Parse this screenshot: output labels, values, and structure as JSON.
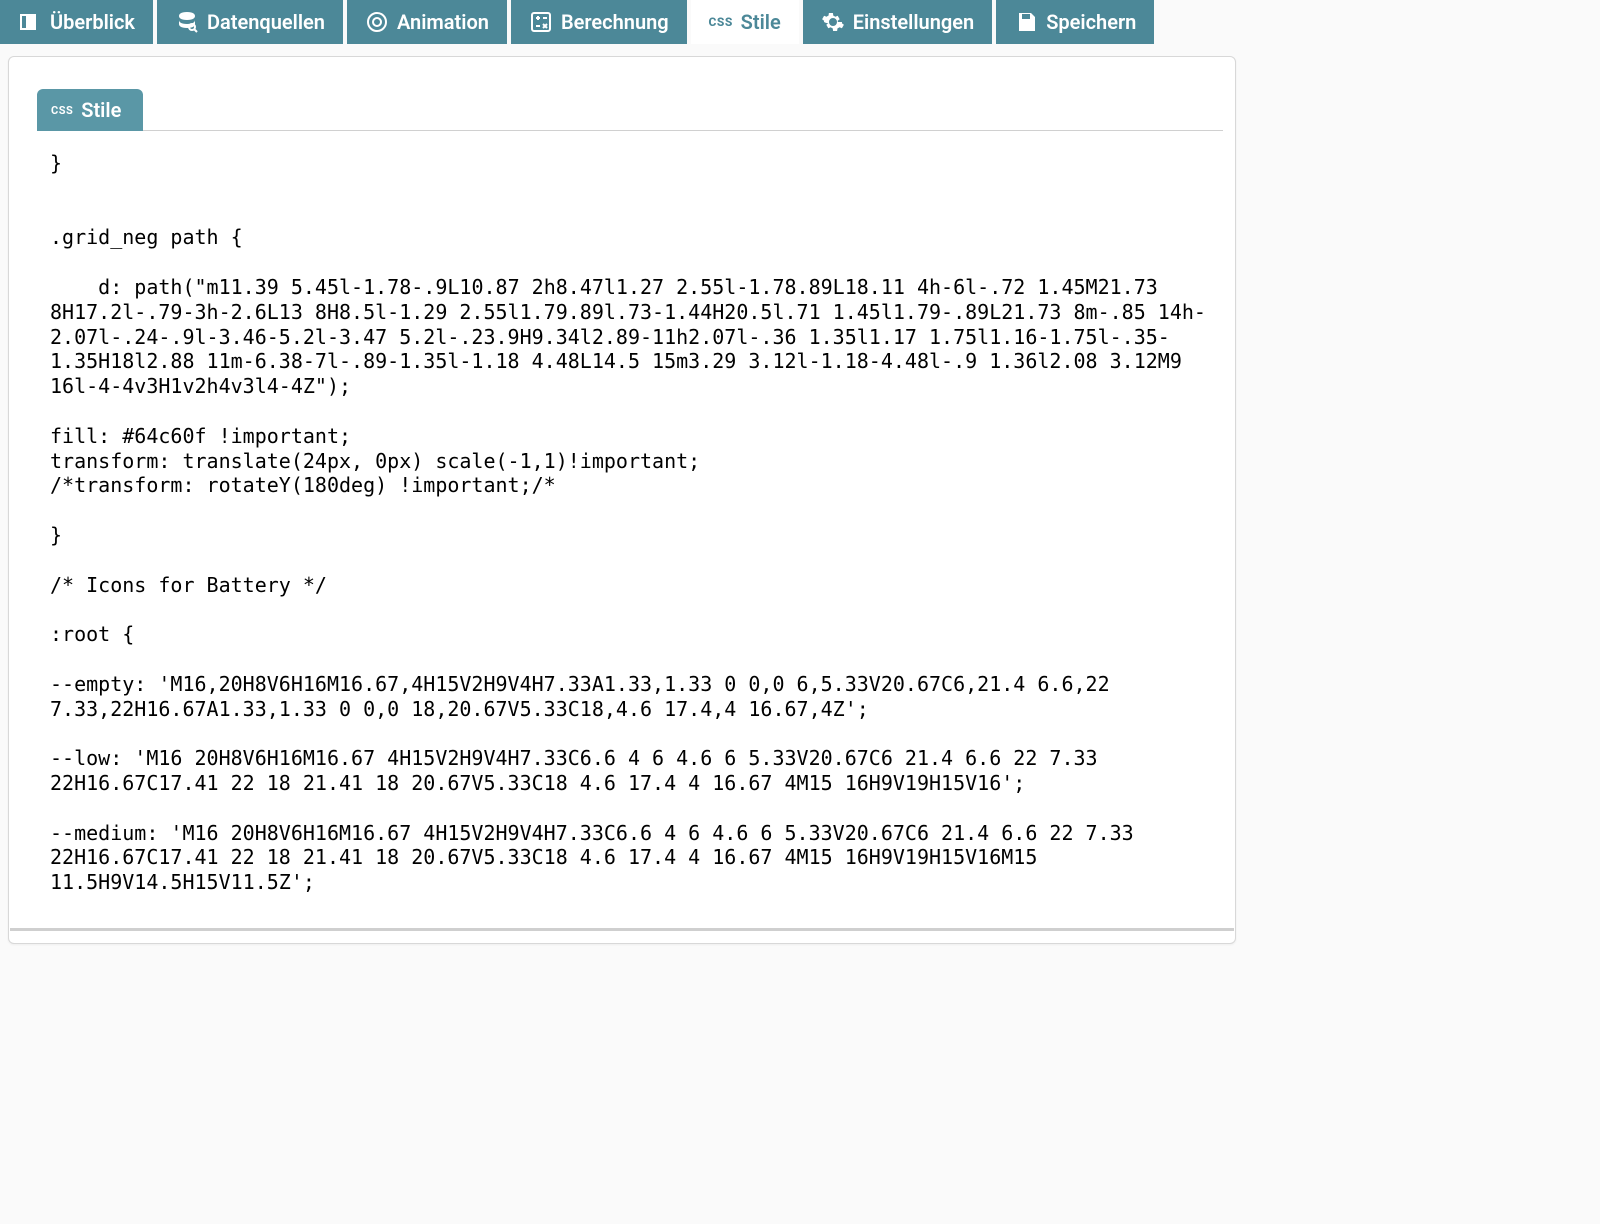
{
  "topTabs": [
    {
      "label": "Überblick"
    },
    {
      "label": "Datenquellen"
    },
    {
      "label": "Animation"
    },
    {
      "label": "Berechnung"
    },
    {
      "label": "Stile",
      "active": true
    },
    {
      "label": "Einstellungen"
    },
    {
      "label": "Speichern"
    }
  ],
  "innerTab": {
    "badge": "CSS",
    "label": "Stile"
  },
  "cssBadge": "CSS",
  "code": "}\n\n\n.grid_neg path {\n\n    d: path(\"m11.39 5.45l-1.78-.9L10.87 2h8.47l1.27 2.55l-1.78.89L18.11 4h-6l-.72 1.45M21.73 8H17.2l-.79-3h-2.6L13 8H8.5l-1.29 2.55l1.79.89l.73-1.44H20.5l.71 1.45l1.79-.89L21.73 8m-.85 14h-2.07l-.24-.9l-3.46-5.2l-3.47 5.2l-.23.9H9.34l2.89-11h2.07l-.36 1.35l1.17 1.75l1.16-1.75l-.35-1.35H18l2.88 11m-6.38-7l-.89-1.35l-1.18 4.48L14.5 15m3.29 3.12l-1.18-4.48l-.9 1.36l2.08 3.12M9 16l-4-4v3H1v2h4v3l4-4Z\");\n\nfill: #64c60f !important;\ntransform: translate(24px, 0px) scale(-1,1)!important;\n/*transform: rotateY(180deg) !important;/*\n\n}\n\n/* Icons for Battery */\n\n:root {\n\n--empty: 'M16,20H8V6H16M16.67,4H15V2H9V4H7.33A1.33,1.33 0 0,0 6,5.33V20.67C6,21.4 6.6,22 7.33,22H16.67A1.33,1.33 0 0,0 18,20.67V5.33C18,4.6 17.4,4 16.67,4Z';\n\n--low: 'M16 20H8V6H16M16.67 4H15V2H9V4H7.33C6.6 4 6 4.6 6 5.33V20.67C6 21.4 6.6 22 7.33 22H16.67C17.41 22 18 21.41 18 20.67V5.33C18 4.6 17.4 4 16.67 4M15 16H9V19H15V16';\n\n--medium: 'M16 20H8V6H16M16.67 4H15V2H9V4H7.33C6.6 4 6 4.6 6 5.33V20.67C6 21.4 6.6 22 7.33 22H16.67C17.41 22 18 21.41 18 20.67V5.33C18 4.6 17.4 4 16.67 4M15 16H9V19H15V16M15 11.5H9V14.5H15V11.5Z';"
}
